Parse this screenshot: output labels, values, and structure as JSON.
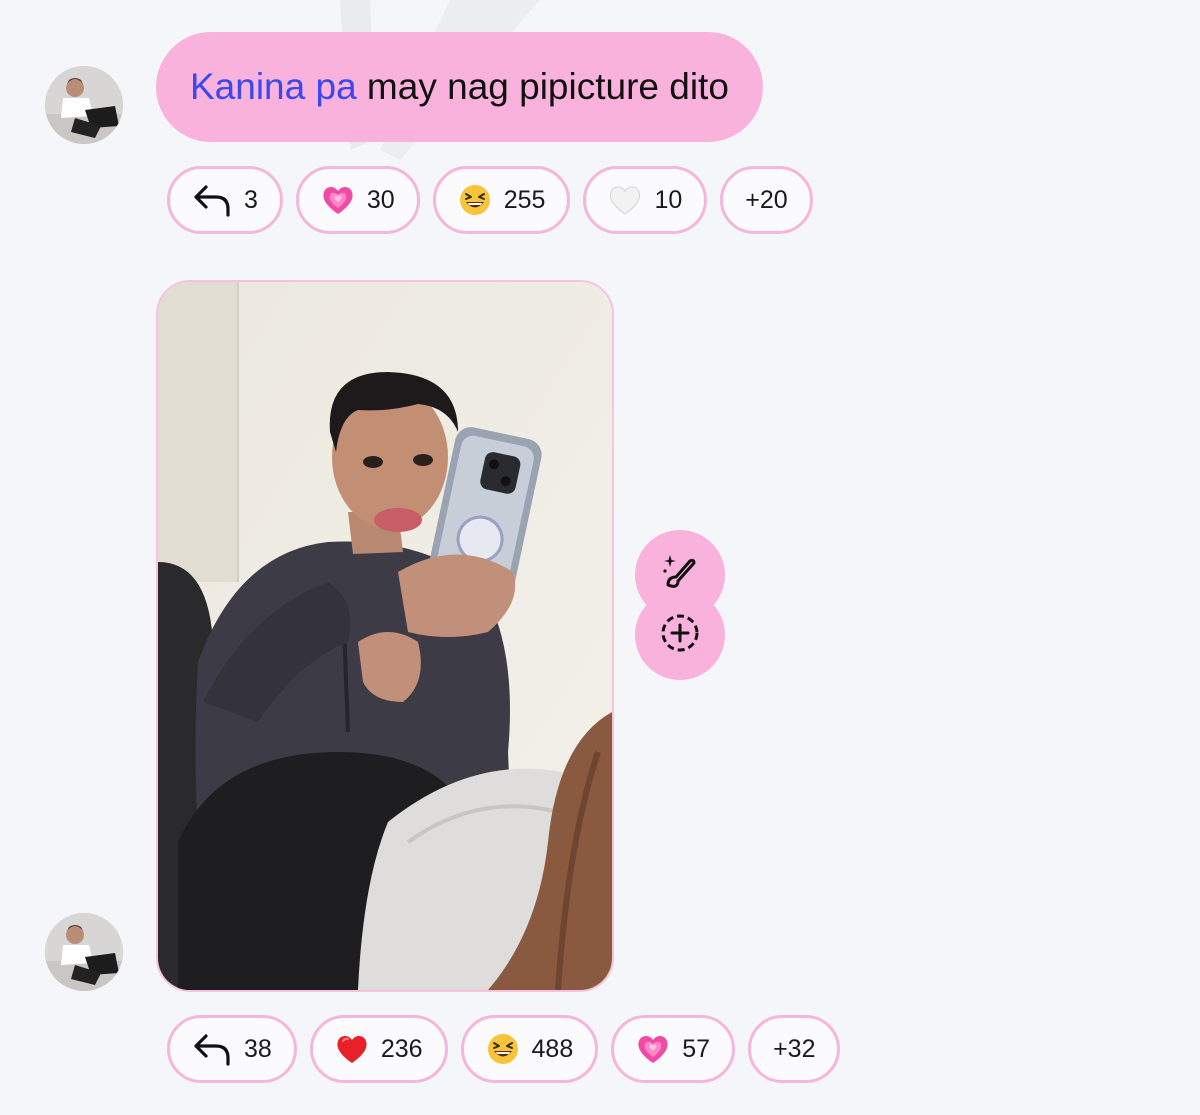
{
  "message_1": {
    "mention": "Kanina pa",
    "text": " may nag pipicture dito",
    "reactions": [
      {
        "icon": "reply-icon",
        "count": "3"
      },
      {
        "icon": "growing-heart-icon",
        "count": "30"
      },
      {
        "icon": "laughing-face-icon",
        "count": "255"
      },
      {
        "icon": "white-heart-icon",
        "count": "10"
      },
      {
        "icon": null,
        "count": "+20"
      }
    ]
  },
  "message_2": {
    "type": "photo",
    "reactions": [
      {
        "icon": "reply-icon",
        "count": "38"
      },
      {
        "icon": "red-heart-icon",
        "count": "236"
      },
      {
        "icon": "laughing-face-icon",
        "count": "488"
      },
      {
        "icon": "growing-heart-icon",
        "count": "57"
      },
      {
        "icon": null,
        "count": "+32"
      }
    ]
  },
  "actions": [
    {
      "icon": "sparkle-brush-icon"
    },
    {
      "icon": "add-reaction-icon"
    }
  ],
  "colors": {
    "bubble": "#f9b2dc",
    "mention": "#3b47f0",
    "pill_border": "#f6b6dc",
    "background": "#f5f6fa"
  }
}
